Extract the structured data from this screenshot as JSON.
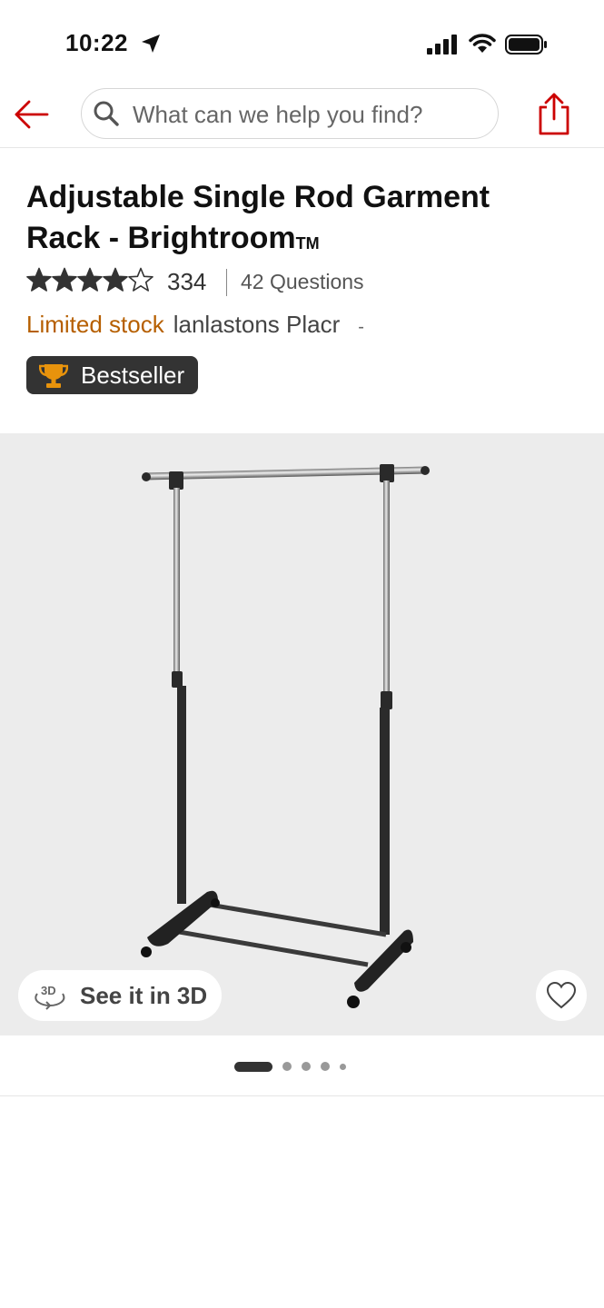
{
  "status_bar": {
    "time": "10:22",
    "icons": [
      "location-arrow-icon",
      "cellular-signal-icon",
      "wifi-icon",
      "battery-icon"
    ]
  },
  "nav": {
    "back_icon": "arrow-left-icon",
    "search_placeholder": "What can we help you find?",
    "share_icon": "share-icon",
    "accent_color": "#cc0000"
  },
  "product": {
    "title": "Adjustable Single Rod Garment Rack - Brightroom",
    "trademark": "TM",
    "rating": 4,
    "rating_max": 5,
    "rating_count": "334",
    "questions": "42 Questions",
    "stock_status": "Limited stock",
    "store_name": "lanlastons Placr",
    "store_suffix": "-",
    "badge": "Bestseller",
    "badge_icon": "trophy-icon"
  },
  "gallery": {
    "see_3d_label": "See it in 3D",
    "see_3d_icon": "rotate-3d-icon",
    "favorite_icon": "heart-icon",
    "image_count": 5,
    "active_index": 0
  },
  "colors": {
    "stock": "#b65f00",
    "badge_bg": "#333333",
    "gallery_bg": "#ececec"
  }
}
